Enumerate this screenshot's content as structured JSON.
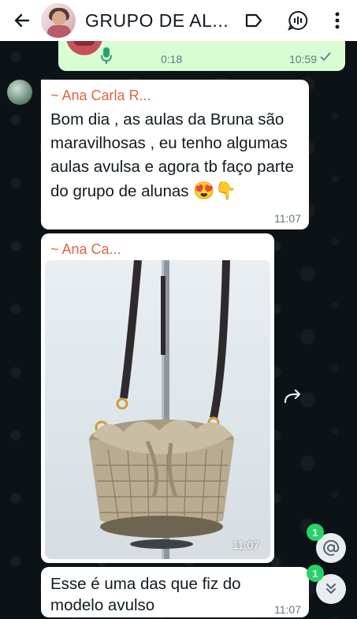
{
  "header": {
    "title": "GRUPO DE AL...",
    "icons": [
      "back-arrow-icon",
      "group-avatar",
      "label-icon",
      "voice-chat-icon",
      "more-vert-icon"
    ]
  },
  "voice_message": {
    "duration": "0:18",
    "time": "10:59"
  },
  "messages": [
    {
      "sender": "~ Ana Carla R...",
      "text": "Bom dia , as aulas da Bruna são maravilhosas , eu tenho algumas aulas avulsa e agora tb faço parte do grupo de alunas",
      "emojis": "😍👇",
      "time": "11:07"
    },
    {
      "sender": "~ Ana Ca...",
      "image": "crochet-bucket-bag-photo",
      "time": "11:07"
    },
    {
      "text": "Esse é uma das que fiz do modelo avulso",
      "time": "11:07"
    }
  ],
  "badges": {
    "mentions_count": "1",
    "unread_count": "1"
  },
  "colors": {
    "outgoing_bubble": "#d9fdd3",
    "incoming_bubble": "#ffffff",
    "sender_name": "#e0663e",
    "badge": "#25d366",
    "wallpaper": "#0c1317"
  }
}
